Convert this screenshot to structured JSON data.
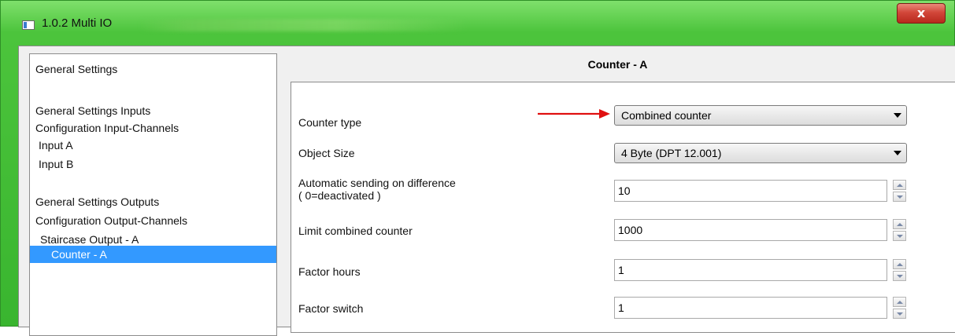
{
  "window": {
    "title": "1.0.2 Multi IO",
    "close_label": "x"
  },
  "tree": {
    "items": [
      {
        "label": "General Settings",
        "selected": false
      },
      {
        "label": "General Settings Inputs",
        "selected": false
      },
      {
        "label": "Configuration Input-Channels",
        "selected": false
      },
      {
        "label": "Input  A",
        "selected": false
      },
      {
        "label": "Input  B",
        "selected": false
      },
      {
        "label": "General Settings Outputs",
        "selected": false
      },
      {
        "label": "Configuration Output-Channels",
        "selected": false
      },
      {
        "label": "Staircase Output - A",
        "selected": false
      },
      {
        "label": "Counter - A",
        "selected": true
      }
    ]
  },
  "panel": {
    "title": "Counter - A",
    "rows": [
      {
        "label": "Counter type",
        "type": "select",
        "value": "Combined counter"
      },
      {
        "label": "Object Size",
        "type": "select",
        "value": "4 Byte (DPT 12.001)"
      },
      {
        "label": "Automatic sending on difference",
        "label2": "( 0=deactivated )",
        "type": "number",
        "value": "10"
      },
      {
        "label": "Limit combined counter",
        "type": "number",
        "value": "1000"
      },
      {
        "label": "Factor hours",
        "type": "number",
        "value": "1"
      },
      {
        "label": "Factor switch",
        "type": "number",
        "value": "1"
      }
    ]
  },
  "colors": {
    "title_bar": "#4cc43c",
    "selection": "#3399ff",
    "annotation_arrow": "#e01010",
    "close_button": "#c9392c"
  }
}
